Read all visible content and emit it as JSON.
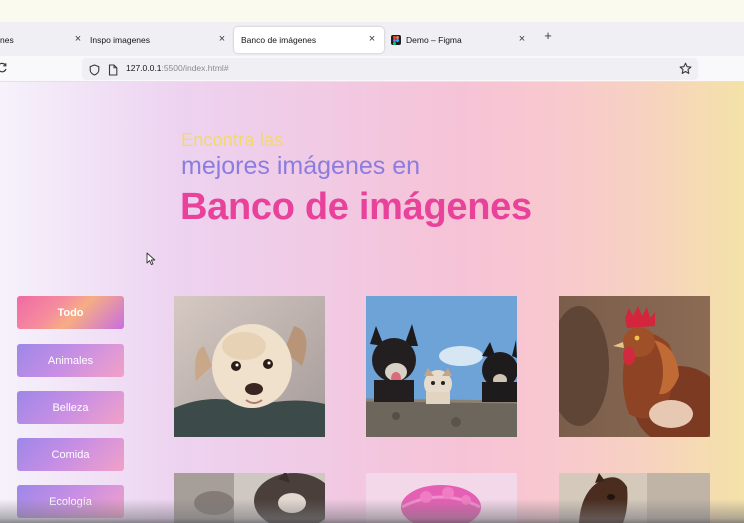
{
  "browser": {
    "tabs": [
      {
        "label": "nes",
        "active": false
      },
      {
        "label": "Inspo imagenes",
        "active": false
      },
      {
        "label": "Banco de imágenes",
        "active": true
      },
      {
        "label": "Demo – Figma",
        "active": false
      }
    ],
    "close_glyph": "×",
    "new_tab_glyph": "+",
    "url_host": "127.0.0.1",
    "url_rest": ":5500/index.html#",
    "icons": [
      "reload-icon",
      "shield-icon",
      "page-icon",
      "bookmark-star-icon",
      "figma-icon",
      "close-icon",
      "plus-icon"
    ]
  },
  "hero": {
    "line1": "Encontra las",
    "line2": "mejores imágenes en",
    "title": "Banco de imágenes"
  },
  "filters": [
    {
      "label": "Todo",
      "active": true
    },
    {
      "label": "Animales",
      "active": false
    },
    {
      "label": "Belleza",
      "active": false
    },
    {
      "label": "Comida",
      "active": false
    },
    {
      "label": "Ecología",
      "active": false
    }
  ],
  "gallery": {
    "images": [
      "puppy-photo",
      "dogs-on-wall-photo",
      "rooster-photo",
      "cat-photo",
      "pink-shower-cap-photo",
      "horse-photo"
    ]
  },
  "colors": {
    "title": "#e8429b",
    "subtitle": "#8b7de0",
    "kicker": "#f2d96a"
  }
}
